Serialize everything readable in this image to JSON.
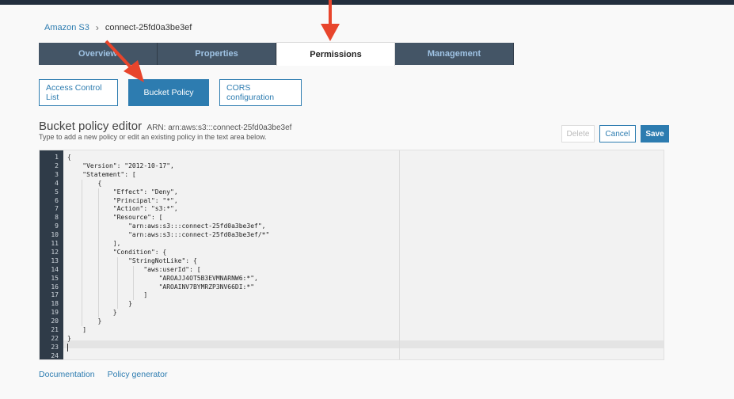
{
  "breadcrumb": {
    "root": "Amazon S3",
    "separator": "›",
    "current": "connect-25fd0a3be3ef"
  },
  "tabs": [
    {
      "label": "Overview"
    },
    {
      "label": "Properties"
    },
    {
      "label": "Permissions"
    },
    {
      "label": "Management"
    }
  ],
  "subtabs": [
    {
      "label": "Access Control List"
    },
    {
      "label": "Bucket Policy"
    },
    {
      "label": "CORS configuration"
    }
  ],
  "editor": {
    "title": "Bucket policy editor",
    "arn": "ARN: arn:aws:s3:::connect-25fd0a3be3ef",
    "hint": "Type to add a new policy or edit an existing policy in the text area below.",
    "buttons": {
      "delete": "Delete",
      "cancel": "Cancel",
      "save": "Save"
    },
    "line_numbers": [
      "1",
      "2",
      "3",
      "4",
      "5",
      "6",
      "7",
      "8",
      "9",
      "10",
      "11",
      "12",
      "13",
      "14",
      "15",
      "16",
      "17",
      "18",
      "19",
      "20",
      "21",
      "22",
      "23",
      "24"
    ],
    "lines": [
      "{",
      "    \"Version\": \"2012-10-17\",",
      "    \"Statement\": [",
      "        {",
      "            \"Effect\": \"Deny\",",
      "            \"Principal\": \"*\",",
      "            \"Action\": \"s3:*\",",
      "            \"Resource\": [",
      "                \"arn:aws:s3:::connect-25fd0a3be3ef\",",
      "                \"arn:aws:s3:::connect-25fd0a3be3ef/*\"",
      "            ],",
      "            \"Condition\": {",
      "                \"StringNotLike\": {",
      "                    \"aws:userId\": [",
      "                        \"AROAJJ4OT5B3EVMNARNW6:*\",",
      "                        \"AROAINV7BYMRZP3NV66DI:*\"",
      "                    ]",
      "                }",
      "            }",
      "        }",
      "    ]",
      "}",
      "",
      ""
    ]
  },
  "footer": {
    "documentation": "Documentation",
    "policy_generator": "Policy generator"
  },
  "colors": {
    "accent": "#2d7cb0",
    "tab_bg": "#445566",
    "annotation_arrow": "#e8452c"
  }
}
